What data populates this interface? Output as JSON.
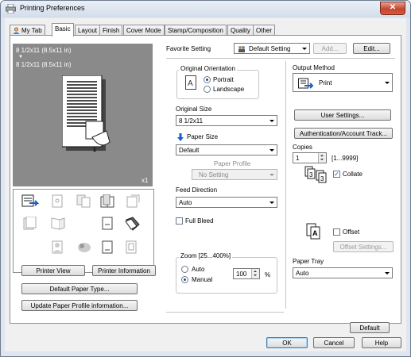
{
  "window": {
    "title": "Printing Preferences",
    "close": "✕"
  },
  "tabs": [
    "My Tab",
    "Basic",
    "Layout",
    "Finish",
    "Cover Mode",
    "Stamp/Composition",
    "Quality",
    "Other"
  ],
  "preview": {
    "paper_line1": "8 1/2x11 (8.5x11 in)",
    "arrow": "▼",
    "paper_line2": "8 1/2x11 (8.5x11 in)",
    "page_number": "1",
    "copies": "x1"
  },
  "left_buttons": {
    "printer_view": "Printer View",
    "printer_information": "Printer Information",
    "default_paper_type": "Default Paper Type...",
    "update_paper_profile": "Update Paper Profile information..."
  },
  "favorite": {
    "label": "Favorite Setting",
    "value": "Default Setting",
    "add": "Add...",
    "edit": "Edit..."
  },
  "orientation": {
    "label": "Original Orientation",
    "portrait": "Portrait",
    "landscape": "Landscape",
    "selected": "Portrait"
  },
  "original_size": {
    "label": "Original Size",
    "value": "8 1/2x11"
  },
  "paper_size": {
    "label": "Paper Size",
    "value": "Default"
  },
  "paper_profile": {
    "label": "Paper Profile",
    "value": "No Setting"
  },
  "feed_direction": {
    "label": "Feed Direction",
    "value": "Auto"
  },
  "full_bleed": {
    "label": "Full Bleed",
    "checked": false
  },
  "zoom": {
    "label": "Zoom [25...400%]",
    "auto": "Auto",
    "manual": "Manual",
    "selected": "Manual",
    "value": "100",
    "unit": "%"
  },
  "output_method": {
    "label": "Output Method",
    "value": "Print"
  },
  "right_buttons": {
    "user_settings": "User Settings...",
    "auth_tracking": "Authentication/Account Track..."
  },
  "copies": {
    "label": "Copies",
    "value": "1",
    "range": "[1...9999]",
    "collate": "Collate",
    "collate_checked": true
  },
  "offset": {
    "label": "Offset",
    "checked": false,
    "settings": "Offset Settings..."
  },
  "paper_tray": {
    "label": "Paper Tray",
    "value": "Auto"
  },
  "default_button": "Default",
  "dialog_buttons": {
    "ok": "OK",
    "cancel": "Cancel",
    "help": "Help"
  }
}
